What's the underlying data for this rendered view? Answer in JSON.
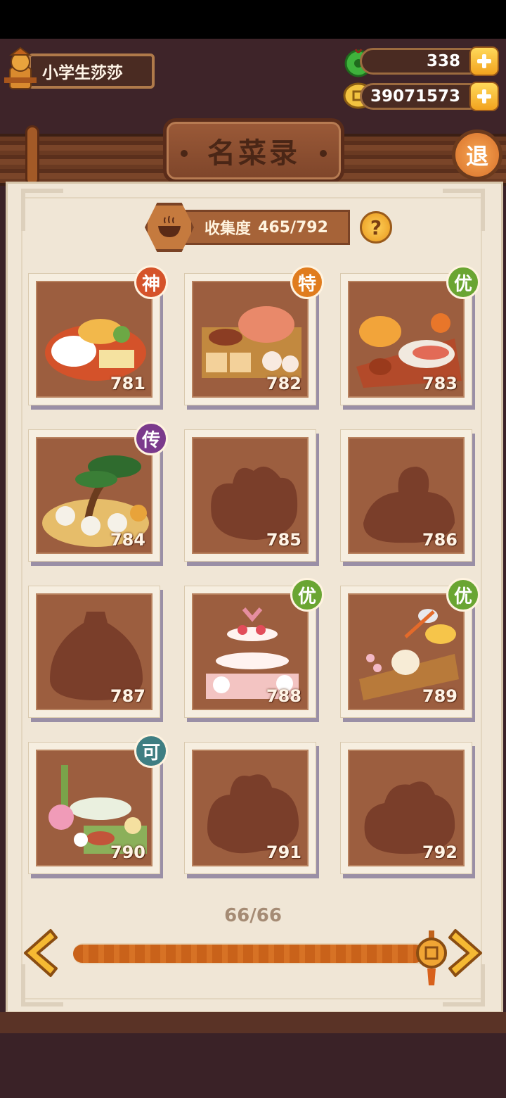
{
  "player": {
    "name": "小学生莎莎"
  },
  "currency": {
    "jade": "338",
    "coins": "39071573"
  },
  "header": {
    "title": "名菜录",
    "exit_label": "退"
  },
  "collection": {
    "label": "收集度",
    "progress": "465/792",
    "help": "?"
  },
  "dishes": [
    {
      "number": "781",
      "rank": "神",
      "rank_color": "#d5532a",
      "unlocked": true
    },
    {
      "number": "782",
      "rank": "特",
      "rank_color": "#e07c1e",
      "unlocked": true
    },
    {
      "number": "783",
      "rank": "优",
      "rank_color": "#6aa532",
      "unlocked": true
    },
    {
      "number": "784",
      "rank": "传",
      "rank_color": "#7b3a8c",
      "unlocked": true
    },
    {
      "number": "785",
      "rank": "",
      "unlocked": false
    },
    {
      "number": "786",
      "rank": "",
      "unlocked": false
    },
    {
      "number": "787",
      "rank": "",
      "unlocked": false
    },
    {
      "number": "788",
      "rank": "优",
      "rank_color": "#6aa532",
      "unlocked": true
    },
    {
      "number": "789",
      "rank": "优",
      "rank_color": "#6aa532",
      "unlocked": true
    },
    {
      "number": "790",
      "rank": "可",
      "rank_color": "#3f7e82",
      "unlocked": true
    },
    {
      "number": "791",
      "rank": "",
      "unlocked": false
    },
    {
      "number": "792",
      "rank": "",
      "unlocked": false
    }
  ],
  "pagination": {
    "page": "66/66",
    "progress": 1.0
  }
}
